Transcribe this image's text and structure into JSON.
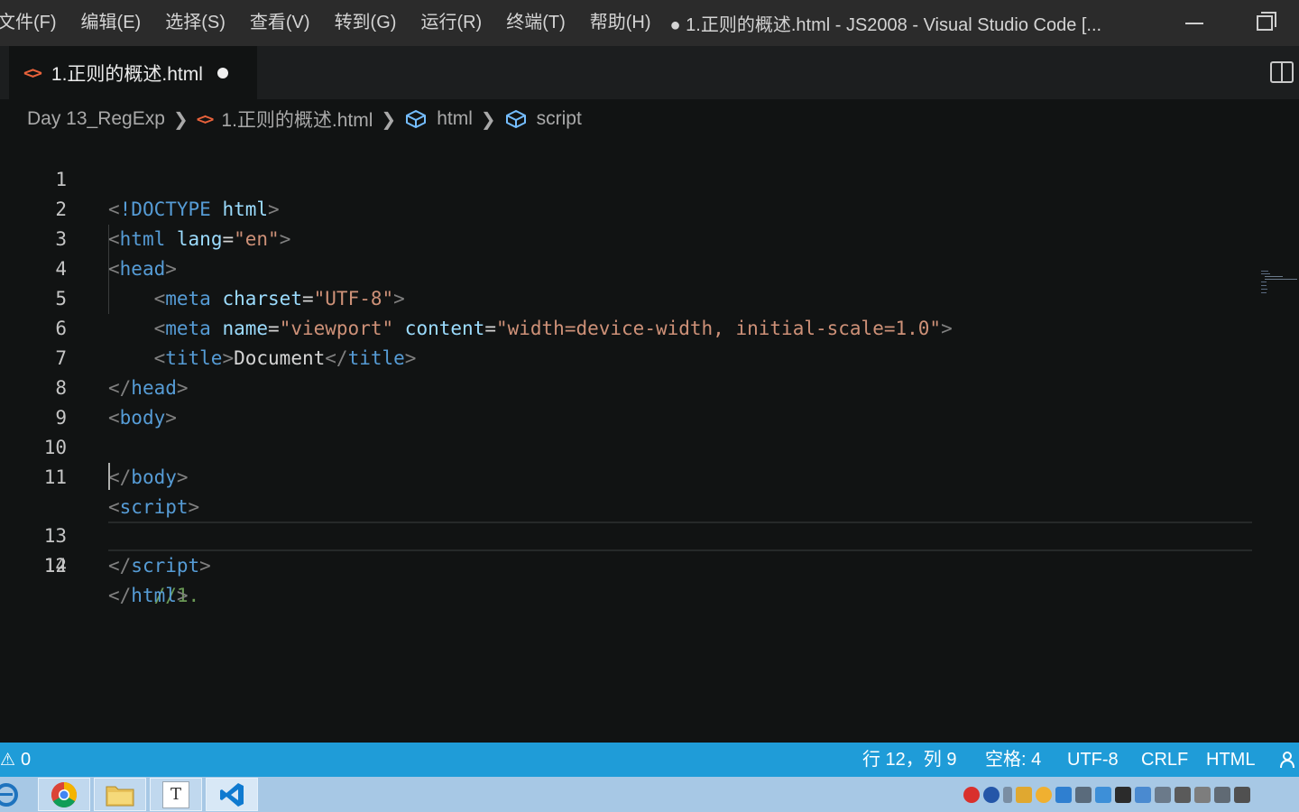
{
  "menu": {
    "items": [
      "文件(F)",
      "编辑(E)",
      "选择(S)",
      "查看(V)",
      "转到(G)",
      "运行(R)",
      "终端(T)",
      "帮助(H)"
    ]
  },
  "window": {
    "title": "● 1.正则的概述.html - JS2008 - Visual Studio Code [..."
  },
  "tab": {
    "label": "1.正则的概述.html",
    "icon": "<>"
  },
  "breadcrumb": {
    "folder": "Day 13_RegExp",
    "file": "1.正则的概述.html",
    "html_node": "html",
    "script_node": "script"
  },
  "editor": {
    "line_numbers": [
      "1",
      "2",
      "3",
      "4",
      "5",
      "6",
      "7",
      "8",
      "9",
      "10",
      "11",
      "12",
      "13",
      "14"
    ],
    "current_line": 12,
    "code": {
      "l1_decl": "!DOCTYPE",
      "l1_name": "html",
      "l2_tag": "html",
      "l2_attr": "lang",
      "l2_val": "\"en\"",
      "l3_tag": "head",
      "l4_tag": "meta",
      "l4_attr": "charset",
      "l4_val": "\"UTF-8\"",
      "l5_tag": "meta",
      "l5_attr1": "name",
      "l5_val1": "\"viewport\"",
      "l5_attr2": "content",
      "l5_val2": "\"width=device-width, initial-scale=1.0\"",
      "l6_tag": "title",
      "l6_text": "Document",
      "l7_tag": "head",
      "l8_tag": "body",
      "l10_tag": "body",
      "l11_tag": "script",
      "l12_comment": "//1.",
      "l13_tag": "script",
      "l14_tag": "html"
    }
  },
  "status": {
    "problems_count": "0",
    "position": "行 12，列 9",
    "spaces": "空格: 4",
    "encoding": "UTF-8",
    "eol": "CRLF",
    "language": "HTML"
  },
  "taskbar": {
    "editor_letter": "T"
  },
  "colors": {
    "statusbar": "#1f9cd8",
    "tag": "#569cd6",
    "attribute": "#9cdcfe",
    "string": "#ce9178",
    "comment": "#6a9955",
    "html_icon": "#e8623b"
  }
}
